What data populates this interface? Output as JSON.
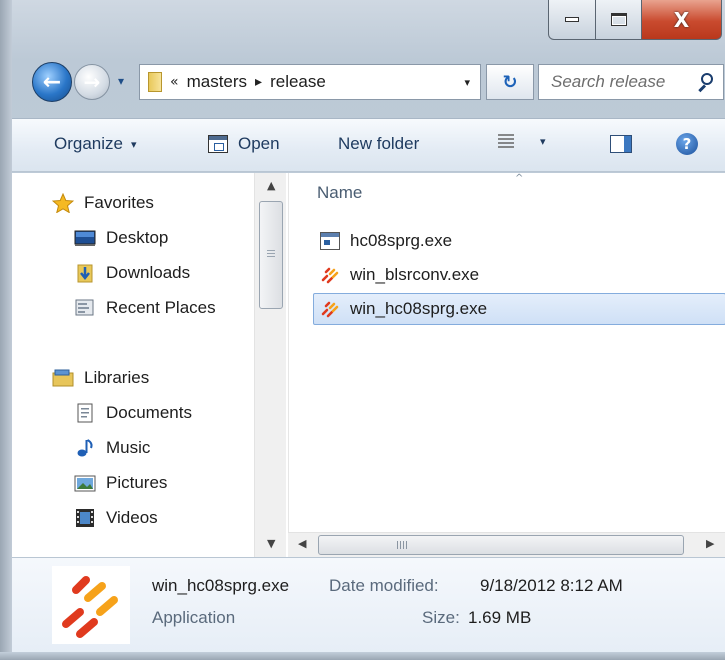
{
  "window": {
    "caption_buttons": {
      "minimize_icon": "minimize-icon",
      "maximize_icon": "maximize-icon",
      "close_glyph": "X"
    }
  },
  "navigation": {
    "back_glyph": "←",
    "forward_glyph": "→",
    "recent_pages_glyph": "▾",
    "address": {
      "overflow_glyph": "«",
      "separator_glyph": "▸",
      "crumbs": [
        "masters",
        "release"
      ],
      "dropdown_glyph": "▾"
    },
    "refresh_glyph": "↻",
    "search": {
      "placeholder": "Search release",
      "value": ""
    }
  },
  "toolbar": {
    "organize_label": "Organize",
    "open_label": "Open",
    "new_folder_label": "New folder",
    "caret_glyph": "▾",
    "help_glyph": "?"
  },
  "sidebar": {
    "items": [
      {
        "label": "Favorites",
        "icon": "star-icon"
      },
      {
        "label": "Desktop",
        "icon": "desktop-icon"
      },
      {
        "label": "Downloads",
        "icon": "downloads-icon"
      },
      {
        "label": "Recent Places",
        "icon": "recent-places-icon"
      },
      {
        "label": "Libraries",
        "icon": "libraries-icon"
      },
      {
        "label": "Documents",
        "icon": "documents-icon"
      },
      {
        "label": "Music",
        "icon": "music-icon"
      },
      {
        "label": "Pictures",
        "icon": "pictures-icon"
      },
      {
        "label": "Videos",
        "icon": "videos-icon"
      }
    ]
  },
  "file_list": {
    "sort_glyph": "^",
    "column_name": "Name",
    "files": [
      {
        "name": "hc08sprg.exe",
        "icon": "application-window-icon",
        "selected": false
      },
      {
        "name": "win_blsrconv.exe",
        "icon": "freescale-app-icon",
        "selected": false
      },
      {
        "name": "win_hc08sprg.exe",
        "icon": "freescale-app-icon",
        "selected": true
      }
    ]
  },
  "scrollbars": {
    "up_glyph": "▲",
    "down_glyph": "▼",
    "left_glyph": "◀",
    "right_glyph": "▶"
  },
  "details": {
    "name": "win_hc08sprg.exe",
    "type": "Application",
    "date_label": "Date modified:",
    "date_value": "9/18/2012 8:12 AM",
    "size_label": "Size:",
    "size_value": "1.69 MB"
  },
  "colors": {
    "selection_fill": "#cfe0f6",
    "selection_border": "#84acdd",
    "close_button": "#c94a2e",
    "accent_blue": "#2a76c8"
  }
}
